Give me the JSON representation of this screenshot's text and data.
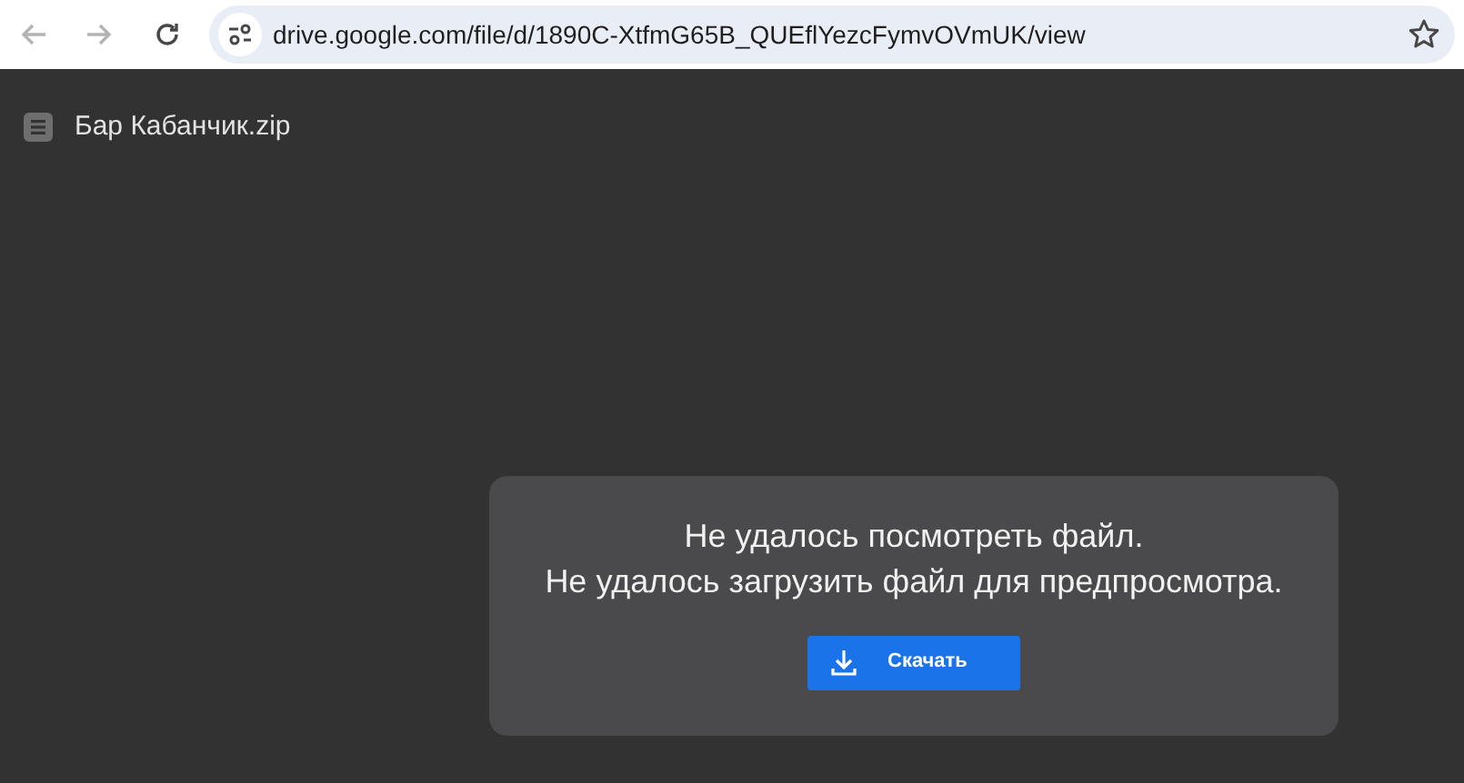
{
  "browser": {
    "nav_buttons": [
      {
        "kind": "back",
        "disabled": true
      },
      {
        "kind": "forward",
        "disabled": true
      },
      {
        "kind": "reload",
        "disabled": false
      }
    ],
    "url": "drive.google.com/file/d/1890C-XtfmG65B_QUEflYezcFymvOVmUK/view"
  },
  "file": {
    "title": "Бар Кабанчик.zip"
  },
  "dialog": {
    "lines": [
      "Не удалось посмотреть файл.",
      "Не удалось загрузить файл для предпросмотра."
    ],
    "button": "Скачать"
  }
}
